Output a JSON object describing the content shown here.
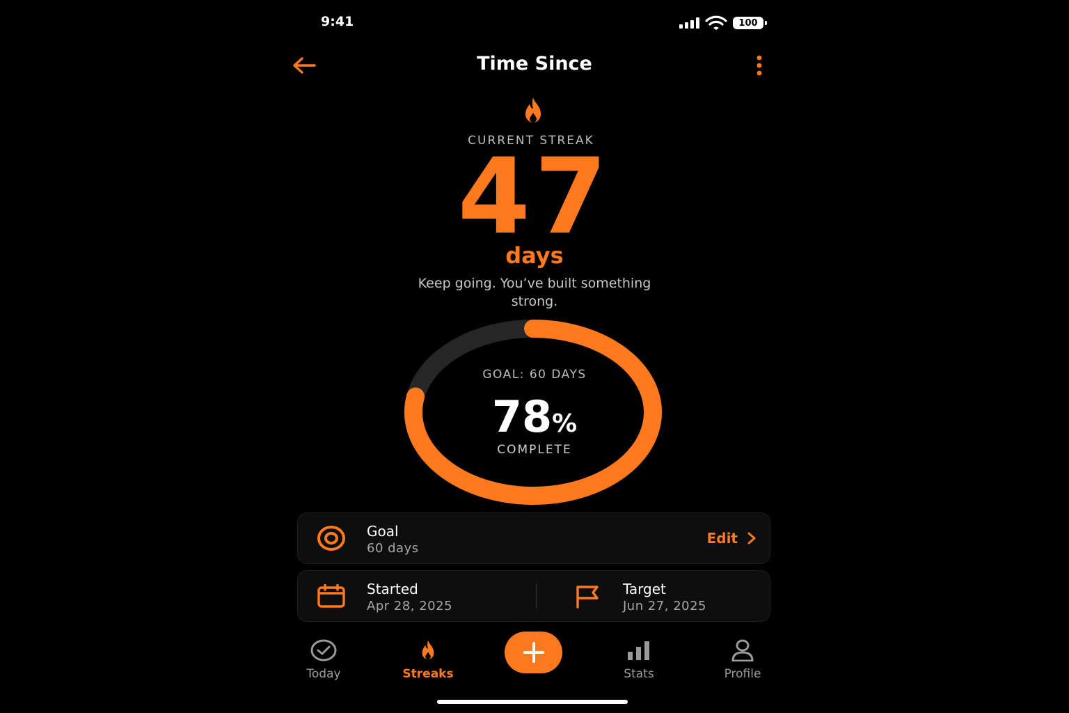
{
  "status_bar": {
    "time": "9:41",
    "battery": "100"
  },
  "header": {
    "title": "Time Since",
    "back_icon": "arrow-left-icon",
    "more_icon": "more-vertical-icon"
  },
  "streak": {
    "icon": "flame-icon",
    "label": "CURRENT STREAK",
    "value": "47",
    "unit": "days",
    "message": "Keep going. You’ve built something strong."
  },
  "progress": {
    "goal_caption": "GOAL: 60 DAYS",
    "percent_value": "78",
    "percent_sign": "%",
    "complete_caption": "COMPLETE",
    "fraction": 0.78
  },
  "goal_card": {
    "icon": "target-icon",
    "title": "Goal",
    "value": "60 days",
    "action_label": "Edit"
  },
  "dates_card": {
    "started": {
      "icon": "calendar-icon",
      "title": "Started",
      "value": "Apr 28, 2025"
    },
    "target": {
      "icon": "flag-icon",
      "title": "Target",
      "value": "Jun 27, 2025"
    }
  },
  "tab_bar": {
    "tabs": [
      {
        "label": "Today",
        "icon": "check-circle-icon",
        "active": false
      },
      {
        "label": "Streaks",
        "icon": "flame-icon",
        "active": true
      },
      {
        "label": "Stats",
        "icon": "bar-chart-icon",
        "active": false
      },
      {
        "label": "Profile",
        "icon": "user-icon",
        "active": false
      }
    ],
    "add_icon": "plus-icon"
  },
  "colors": {
    "accent": "#ff7a1f",
    "background": "#000000",
    "card": "#0e0e0e",
    "track": "#262626",
    "muted_text": "#a8a8a8"
  }
}
